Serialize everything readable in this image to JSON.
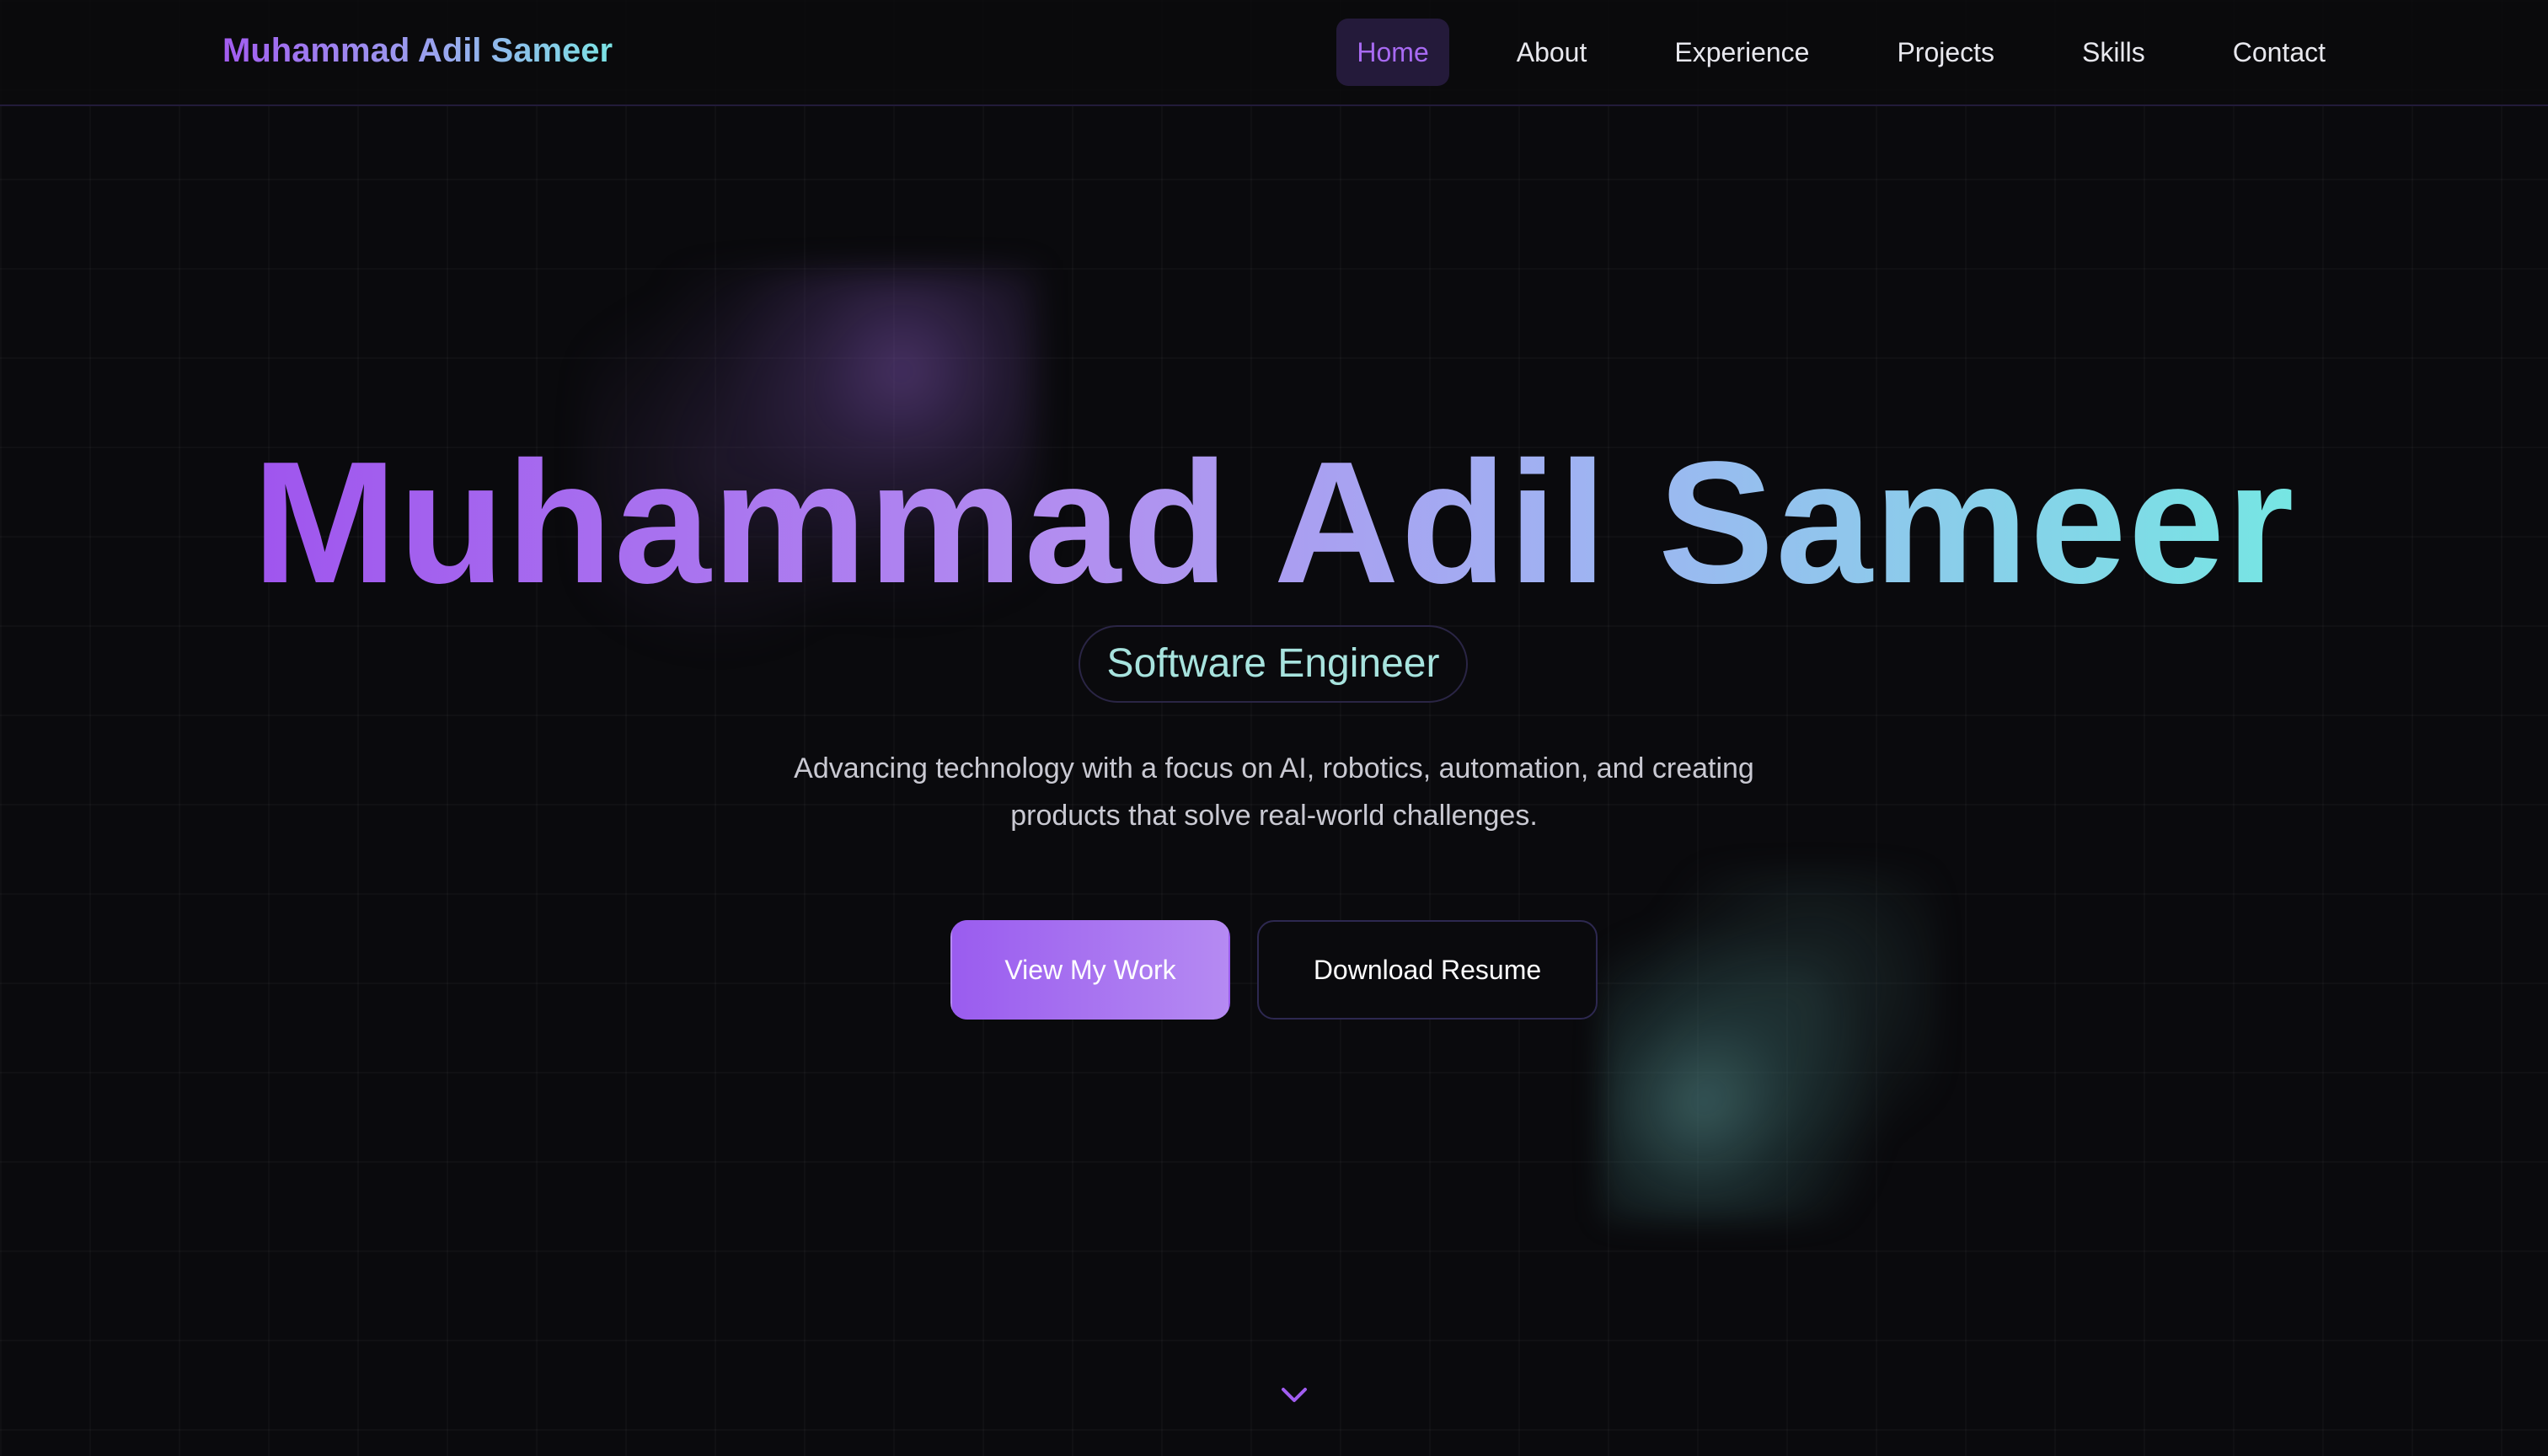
{
  "navbar": {
    "brand": "Muhammad Adil Sameer",
    "links": [
      {
        "label": "Home",
        "active": true
      },
      {
        "label": "About",
        "active": false
      },
      {
        "label": "Experience",
        "active": false
      },
      {
        "label": "Projects",
        "active": false
      },
      {
        "label": "Skills",
        "active": false
      },
      {
        "label": "Contact",
        "active": false
      }
    ]
  },
  "hero": {
    "title": "Muhammad Adil Sameer",
    "role": "Software Engineer",
    "tagline_line1": "Advancing technology with a focus on AI, robotics, automation, and creating",
    "tagline_line2": "products that solve real-world challenges.",
    "primary_button": "View My Work",
    "secondary_button": "Download Resume",
    "scroll_icon": "chevron-down-icon"
  },
  "colors": {
    "background": "#0a0a0d",
    "accent_purple": "#9f55ee",
    "accent_teal": "#76e6e3",
    "nav_active_bg": "#241a3a"
  }
}
